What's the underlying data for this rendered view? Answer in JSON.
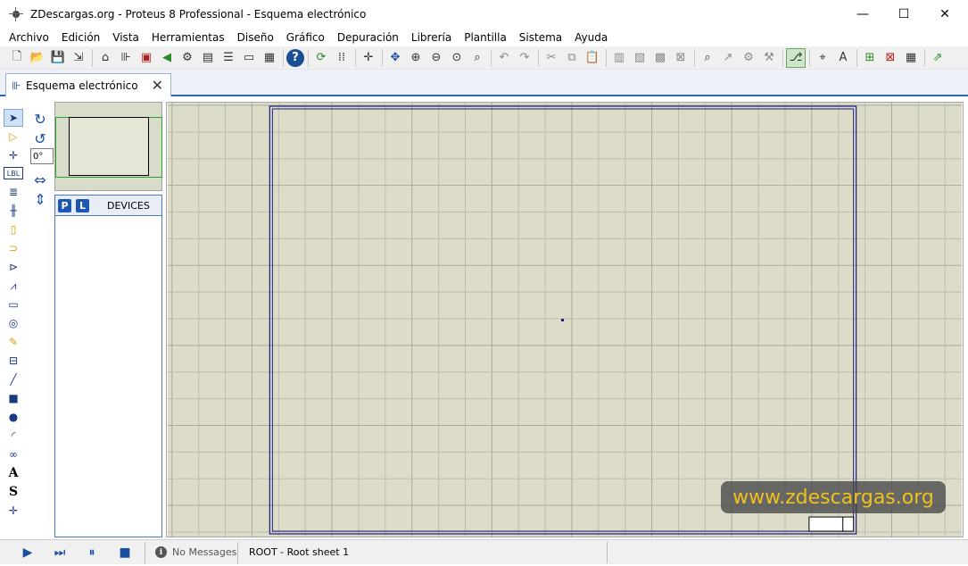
{
  "window": {
    "title": "ZDescargas.org - Proteus 8 Professional - Esquema electrónico",
    "controls": {
      "minimize": "—",
      "maximize": "☐",
      "close": "✕"
    }
  },
  "menu": [
    "Archivo",
    "Edición",
    "Vista",
    "Herramientas",
    "Diseño",
    "Gráfico",
    "Depuración",
    "Librería",
    "Plantilla",
    "Sistema",
    "Ayuda"
  ],
  "toolbar": {
    "groups": [
      [
        {
          "name": "new-icon",
          "glyph": "🗋",
          "style": ""
        },
        {
          "name": "open-folder-icon",
          "glyph": "📂",
          "style": ""
        },
        {
          "name": "save-icon",
          "glyph": "💾",
          "style": "blue"
        },
        {
          "name": "import-icon",
          "glyph": "⇲",
          "style": ""
        }
      ],
      [
        {
          "name": "home-icon",
          "glyph": "⌂",
          "style": ""
        },
        {
          "name": "schematic-icon",
          "glyph": "⊪",
          "style": ""
        },
        {
          "name": "pcb-icon",
          "glyph": "▣",
          "style": "red"
        },
        {
          "name": "gerber-icon",
          "glyph": "◀",
          "style": "green"
        },
        {
          "name": "3d-viewer-icon",
          "glyph": "⚙",
          "style": ""
        },
        {
          "name": "bom-icon",
          "glyph": "▤",
          "style": ""
        },
        {
          "name": "notes-icon",
          "glyph": "☰",
          "style": ""
        },
        {
          "name": "source-code-icon",
          "glyph": "▭",
          "style": ""
        },
        {
          "name": "document-icon",
          "glyph": "▦",
          "style": ""
        }
      ],
      [
        {
          "name": "help-icon",
          "glyph": "?",
          "style": "help"
        }
      ],
      [
        {
          "name": "refresh-icon",
          "glyph": "⟳",
          "style": "green"
        },
        {
          "name": "grid-icon",
          "glyph": "⁞⁞",
          "style": ""
        }
      ],
      [
        {
          "name": "origin-icon",
          "glyph": "✛",
          "style": ""
        }
      ],
      [
        {
          "name": "pan-icon",
          "glyph": "✥",
          "style": "blue"
        },
        {
          "name": "zoom-in-icon",
          "glyph": "⊕",
          "style": ""
        },
        {
          "name": "zoom-out-icon",
          "glyph": "⊖",
          "style": ""
        },
        {
          "name": "zoom-all-icon",
          "glyph": "⊙",
          "style": ""
        },
        {
          "name": "zoom-area-icon",
          "glyph": "⌕",
          "style": ""
        }
      ],
      [
        {
          "name": "undo-icon",
          "glyph": "↶",
          "style": "gray"
        },
        {
          "name": "redo-icon",
          "glyph": "↷",
          "style": "gray"
        }
      ],
      [
        {
          "name": "cut-icon",
          "glyph": "✂",
          "style": "gray"
        },
        {
          "name": "copy-icon",
          "glyph": "⧉",
          "style": "gray"
        },
        {
          "name": "paste-icon",
          "glyph": "📋",
          "style": "gray"
        }
      ],
      [
        {
          "name": "block-copy-icon",
          "glyph": "▥",
          "style": "gray"
        },
        {
          "name": "block-move-icon",
          "glyph": "▧",
          "style": "gray"
        },
        {
          "name": "block-rotate-icon",
          "glyph": "▩",
          "style": "gray"
        },
        {
          "name": "block-delete-icon",
          "glyph": "⊠",
          "style": "gray"
        }
      ],
      [
        {
          "name": "pick-device-icon",
          "glyph": "⌕",
          "style": ""
        },
        {
          "name": "make-device-icon",
          "glyph": "↗",
          "style": "gray"
        },
        {
          "name": "packaging-tool-icon",
          "glyph": "⚙",
          "style": "gray"
        },
        {
          "name": "decompose-icon",
          "glyph": "⚒",
          "style": "gray"
        }
      ],
      [
        {
          "name": "wire-autorouter-icon",
          "glyph": "⎇",
          "style": "active"
        }
      ],
      [
        {
          "name": "search-tag-icon",
          "glyph": "⌖",
          "style": ""
        },
        {
          "name": "property-assignment-icon",
          "glyph": "A",
          "style": ""
        }
      ],
      [
        {
          "name": "new-sheet-icon",
          "glyph": "⊞",
          "style": "green"
        },
        {
          "name": "remove-sheet-icon",
          "glyph": "⊠",
          "style": "red"
        },
        {
          "name": "exit-to-parent-icon",
          "glyph": "▦",
          "style": ""
        }
      ],
      [
        {
          "name": "netlist-to-pcb-icon",
          "glyph": "⇗",
          "style": "green"
        }
      ]
    ]
  },
  "tab": {
    "label": "Esquema electrónico",
    "close": "✕"
  },
  "left_tools": [
    {
      "name": "selection-mode-icon",
      "glyph": "➤",
      "style": "sel"
    },
    {
      "name": "component-mode-icon",
      "glyph": "▷",
      "style": "yellow"
    },
    {
      "name": "junction-dot-icon",
      "glyph": "✛",
      "style": ""
    },
    {
      "name": "wire-label-icon",
      "glyph": "LBL",
      "style": ""
    },
    {
      "name": "text-script-icon",
      "glyph": "≣",
      "style": ""
    },
    {
      "name": "buses-icon",
      "glyph": "╫",
      "style": ""
    },
    {
      "name": "subcircuit-icon",
      "glyph": "▯",
      "style": "yellow"
    },
    {
      "name": "terminals-icon",
      "glyph": "⊃",
      "style": "yellow"
    },
    {
      "name": "device-pins-icon",
      "glyph": "⊳",
      "style": ""
    },
    {
      "name": "graph-mode-icon",
      "glyph": "⩘",
      "style": ""
    },
    {
      "name": "tape-recorder-icon",
      "glyph": "▭",
      "style": ""
    },
    {
      "name": "generator-icon",
      "glyph": "◎",
      "style": ""
    },
    {
      "name": "voltage-probe-icon",
      "glyph": "✎",
      "style": "yellow"
    },
    {
      "name": "virtual-instruments-icon",
      "glyph": "⊟",
      "style": ""
    },
    {
      "name": "line-icon",
      "glyph": "╱",
      "style": ""
    },
    {
      "name": "box-icon",
      "glyph": "■",
      "style": ""
    },
    {
      "name": "circle-icon",
      "glyph": "●",
      "style": ""
    },
    {
      "name": "arc-icon",
      "glyph": "◜",
      "style": ""
    },
    {
      "name": "closed-path-icon",
      "glyph": "∞",
      "style": ""
    },
    {
      "name": "text-icon",
      "glyph": "A",
      "style": "strong"
    },
    {
      "name": "symbol-icon",
      "glyph": "S",
      "style": "strong"
    },
    {
      "name": "marker-icon",
      "glyph": "✛",
      "style": ""
    }
  ],
  "rotation": {
    "rotate_cw": "↻",
    "rotate_ccw": "↺",
    "angle": "0°",
    "mirror_x": "⇔",
    "mirror_y": "⇕"
  },
  "devices_panel": {
    "p": "P",
    "l": "L",
    "title": "DEVICES"
  },
  "status": {
    "play": "▶",
    "step": "⏭",
    "pause": "⏸",
    "stop": "■",
    "msg_icon": "i",
    "messages": "No Messages",
    "sheet": "ROOT - Root sheet 1"
  },
  "watermark": "www.zdescargas.org",
  "colors": {
    "canvas_bg": "#dcdcc8",
    "grid_minor": "#bdbdae",
    "grid_major": "#a9a99a",
    "sheet_border": "#1b1b80",
    "accent": "#2f66b3"
  }
}
